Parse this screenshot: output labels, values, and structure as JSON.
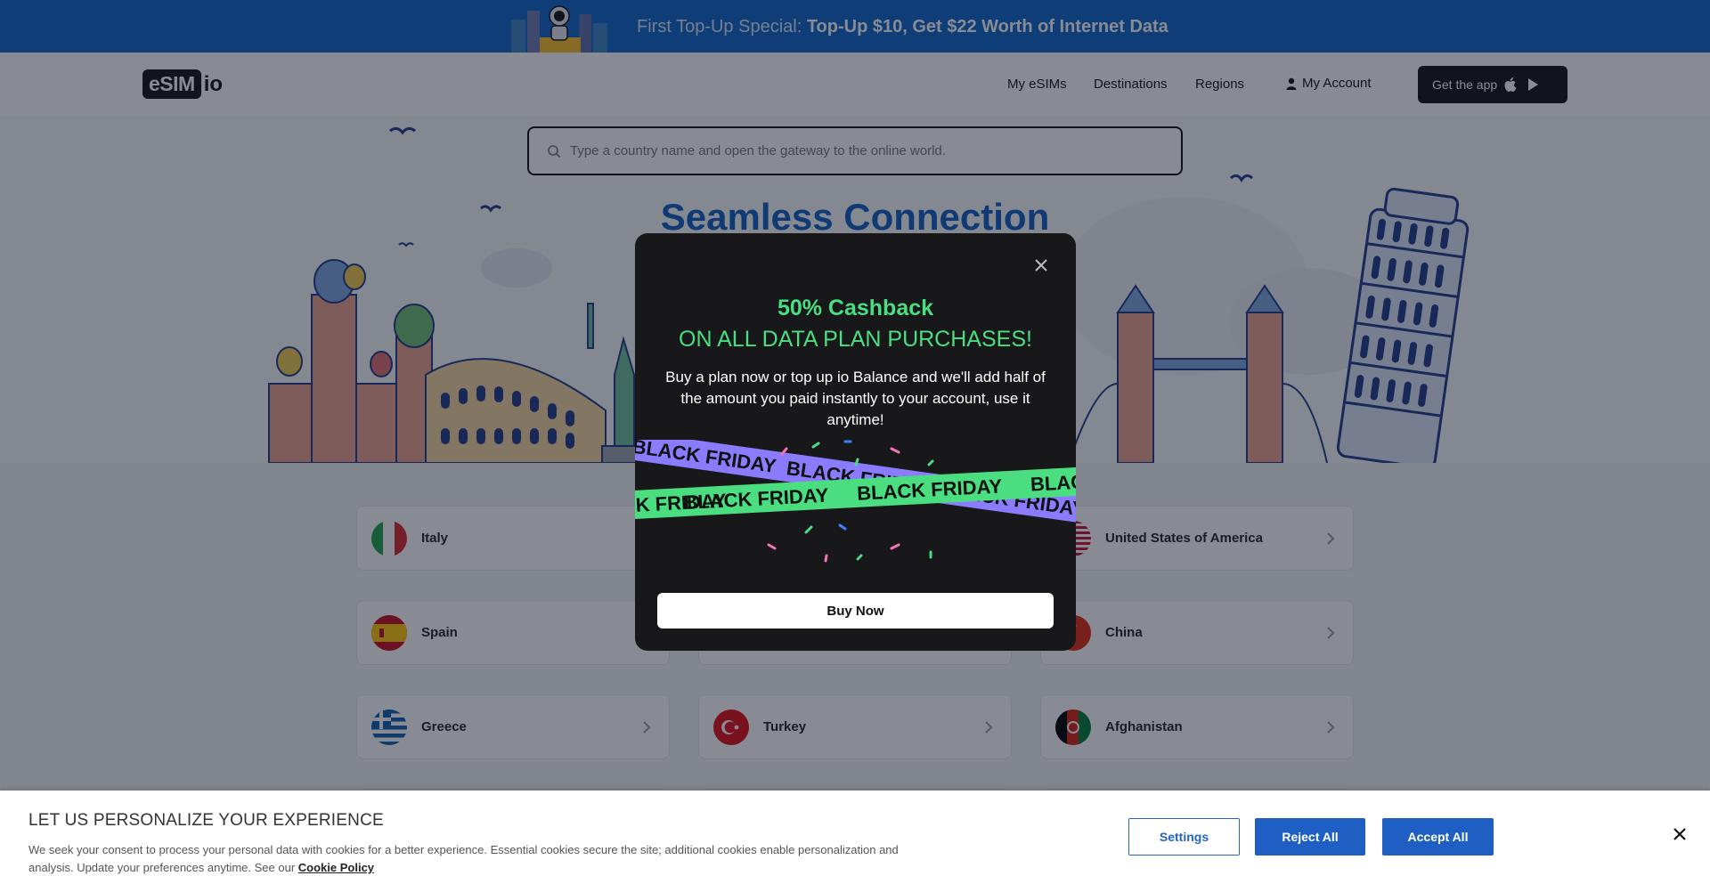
{
  "promo": {
    "lead": "First Top-Up Special: ",
    "highlight": "Top-Up $10, Get $22 Worth of Internet Data"
  },
  "header": {
    "logo_box": "eSIM",
    "logo_suffix": "io",
    "nav": [
      "My eSIMs",
      "Destinations",
      "Regions"
    ],
    "account_label": "My Account",
    "get_app_label": "Get the app"
  },
  "search": {
    "placeholder": "Type a country name and open the gateway to the online world."
  },
  "hero": {
    "title": "Seamless Connection"
  },
  "countries": [
    {
      "name": "Italy",
      "flag": "italy"
    },
    {
      "name": "",
      "flag": ""
    },
    {
      "name": "United States of America",
      "flag": "usa"
    },
    {
      "name": "Spain",
      "flag": "spain"
    },
    {
      "name": "",
      "flag": ""
    },
    {
      "name": "China",
      "flag": "china"
    },
    {
      "name": "Greece",
      "flag": "greece"
    },
    {
      "name": "Turkey",
      "flag": "turkey"
    },
    {
      "name": "Afghanistan",
      "flag": "afghanistan"
    }
  ],
  "modal": {
    "heading": "50% Cashback",
    "subheading": "ON ALL DATA PLAN PURCHASES!",
    "body": "Buy a plan now or top up io Balance and we'll add half of the amount you paid instantly to your account, use it anytime!",
    "ribbon_text": "BLACK FRIDAY",
    "buy_label": "Buy Now"
  },
  "cookie": {
    "title": "LET US PERSONALIZE YOUR EXPERIENCE",
    "description": "We seek your consent to process your personal data with cookies for a better experience. Essential cookies secure the site; additional cookies enable personalization and analysis. Update your preferences anytime. See our ",
    "policy_link": "Cookie Policy",
    "settings_label": "Settings",
    "reject_label": "Reject All",
    "accept_label": "Accept All"
  },
  "colors": {
    "brand_blue": "#0a63c9",
    "accent_green": "#4ade80",
    "ribbon_purple": "#8b7bff",
    "modal_bg": "#18181b"
  }
}
